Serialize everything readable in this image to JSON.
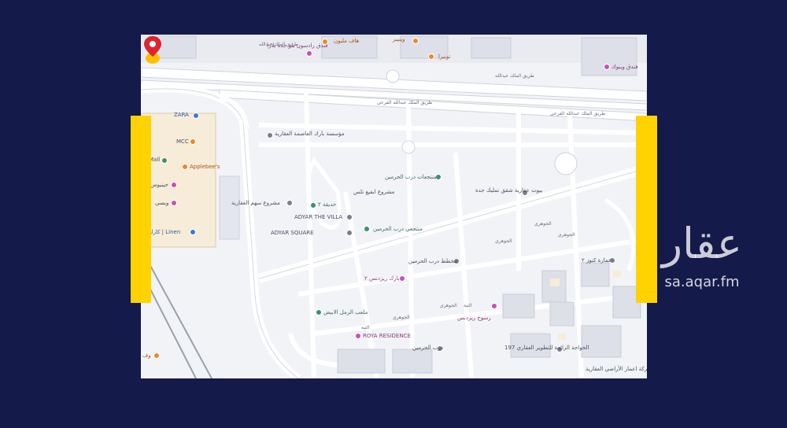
{
  "colors": {
    "background": "#141a4a",
    "accent": "#ffd200",
    "map_bg": "#f2f3f7",
    "road": "#ffffff",
    "road_outline": "#cfd3de",
    "poi_green": "#3f8f6e",
    "poi_pink": "#c94fb6",
    "poi_orange": "#e88a2a",
    "poi_gray": "#7a7f8c",
    "poi_blue": "#3a78d8",
    "pin": "#e0242b"
  },
  "watermark": {
    "logo_text": "عقار",
    "url": "sa.aqar.fm"
  },
  "map": {
    "roads": [
      {
        "label": "طريق الملك عبدالله"
      },
      {
        "label": "طريق الملك عبدالله"
      },
      {
        "label": "طريق الملك عبدالله الفرعي"
      },
      {
        "label": "طريق الملك عبدالله الفرعي"
      }
    ],
    "places": [
      {
        "label": "فندق رادسون بلو جدة بلازا",
        "icon": "hotel-icon",
        "kind": "pink"
      },
      {
        "label": "هاف مليون",
        "icon": "cafe-icon",
        "kind": "orange"
      },
      {
        "label": "وينيبر",
        "icon": "restaurant-icon",
        "kind": "orange"
      },
      {
        "label": "تونيرا",
        "icon": "restaurant-icon",
        "kind": "orange"
      },
      {
        "label": "فندق ويبوك",
        "icon": "hotel-icon",
        "kind": "pink"
      },
      {
        "label": "ZARA",
        "icon": "shopping-icon",
        "kind": "blue"
      },
      {
        "label": "MCC",
        "icon": "shopping-icon",
        "kind": "orange"
      },
      {
        "label": "Applebee's",
        "icon": "restaurant-icon",
        "kind": "orange"
      },
      {
        "label": "Mall",
        "icon": "shopping-icon",
        "kind": "green"
      },
      {
        "label": "جينيوس",
        "icon": "shopping-icon",
        "kind": "pink"
      },
      {
        "label": "ويسي",
        "icon": "shopping-icon",
        "kind": "pink"
      },
      {
        "label": "كارلتن | Linen",
        "icon": "shopping-icon",
        "kind": "blue"
      },
      {
        "label": "مؤسسة بارك العاصمة العقارية",
        "icon": "building-icon",
        "kind": "gray"
      },
      {
        "label": "مشروع سهم العقارية",
        "icon": "building-icon",
        "kind": "gray"
      },
      {
        "label": "حديقة ٢",
        "icon": "park-icon",
        "kind": "green"
      },
      {
        "label": "ADYAR THE VILLA",
        "icon": "building-icon",
        "kind": "gray"
      },
      {
        "label": "ADYAR SQUARE",
        "icon": "building-icon",
        "kind": "gray"
      },
      {
        "label": "مشروع ابفيغ تلس",
        "icon": "building-icon",
        "kind": "gray"
      },
      {
        "label": "منتجعات درب الحرمين",
        "icon": "park-icon",
        "kind": "green"
      },
      {
        "label": "منتجعي درب الحرمين",
        "icon": "park-icon",
        "kind": "green"
      },
      {
        "label": "بيوت عقارية شقق تمليك جدة",
        "icon": "building-icon",
        "kind": "gray"
      },
      {
        "label": "مخطط درب الحرمين",
        "icon": "building-icon",
        "kind": "gray"
      },
      {
        "label": "بارك ريزدنس ٢",
        "icon": "residence-icon",
        "kind": "pink"
      },
      {
        "label": "ملعب الرمل الابيض",
        "icon": "park-icon",
        "kind": "green"
      },
      {
        "label": "رسوخ ريزدنس",
        "icon": "residence-icon",
        "kind": "pink"
      },
      {
        "label": "ROYA RESIDENCE",
        "icon": "residence-icon",
        "kind": "pink"
      },
      {
        "label": "درب الحرمين",
        "icon": "building-icon",
        "kind": "gray"
      },
      {
        "label": "عمارة كنوز ٢",
        "icon": "building-icon",
        "kind": "gray"
      },
      {
        "label": "الخواجة الرائدة للتطوير العقاري 197",
        "icon": "building-icon",
        "kind": "gray"
      },
      {
        "label": "شركة اعمار الأراضي العقارية",
        "icon": "building-icon",
        "kind": "gray"
      },
      {
        "label": "وف",
        "icon": "restaurant-icon",
        "kind": "orange"
      }
    ],
    "street_labels": [
      "الجوهري",
      "الجوهري",
      "الجوهري",
      "الجوهري",
      "التبة",
      "التبة",
      "الجوهري"
    ]
  }
}
